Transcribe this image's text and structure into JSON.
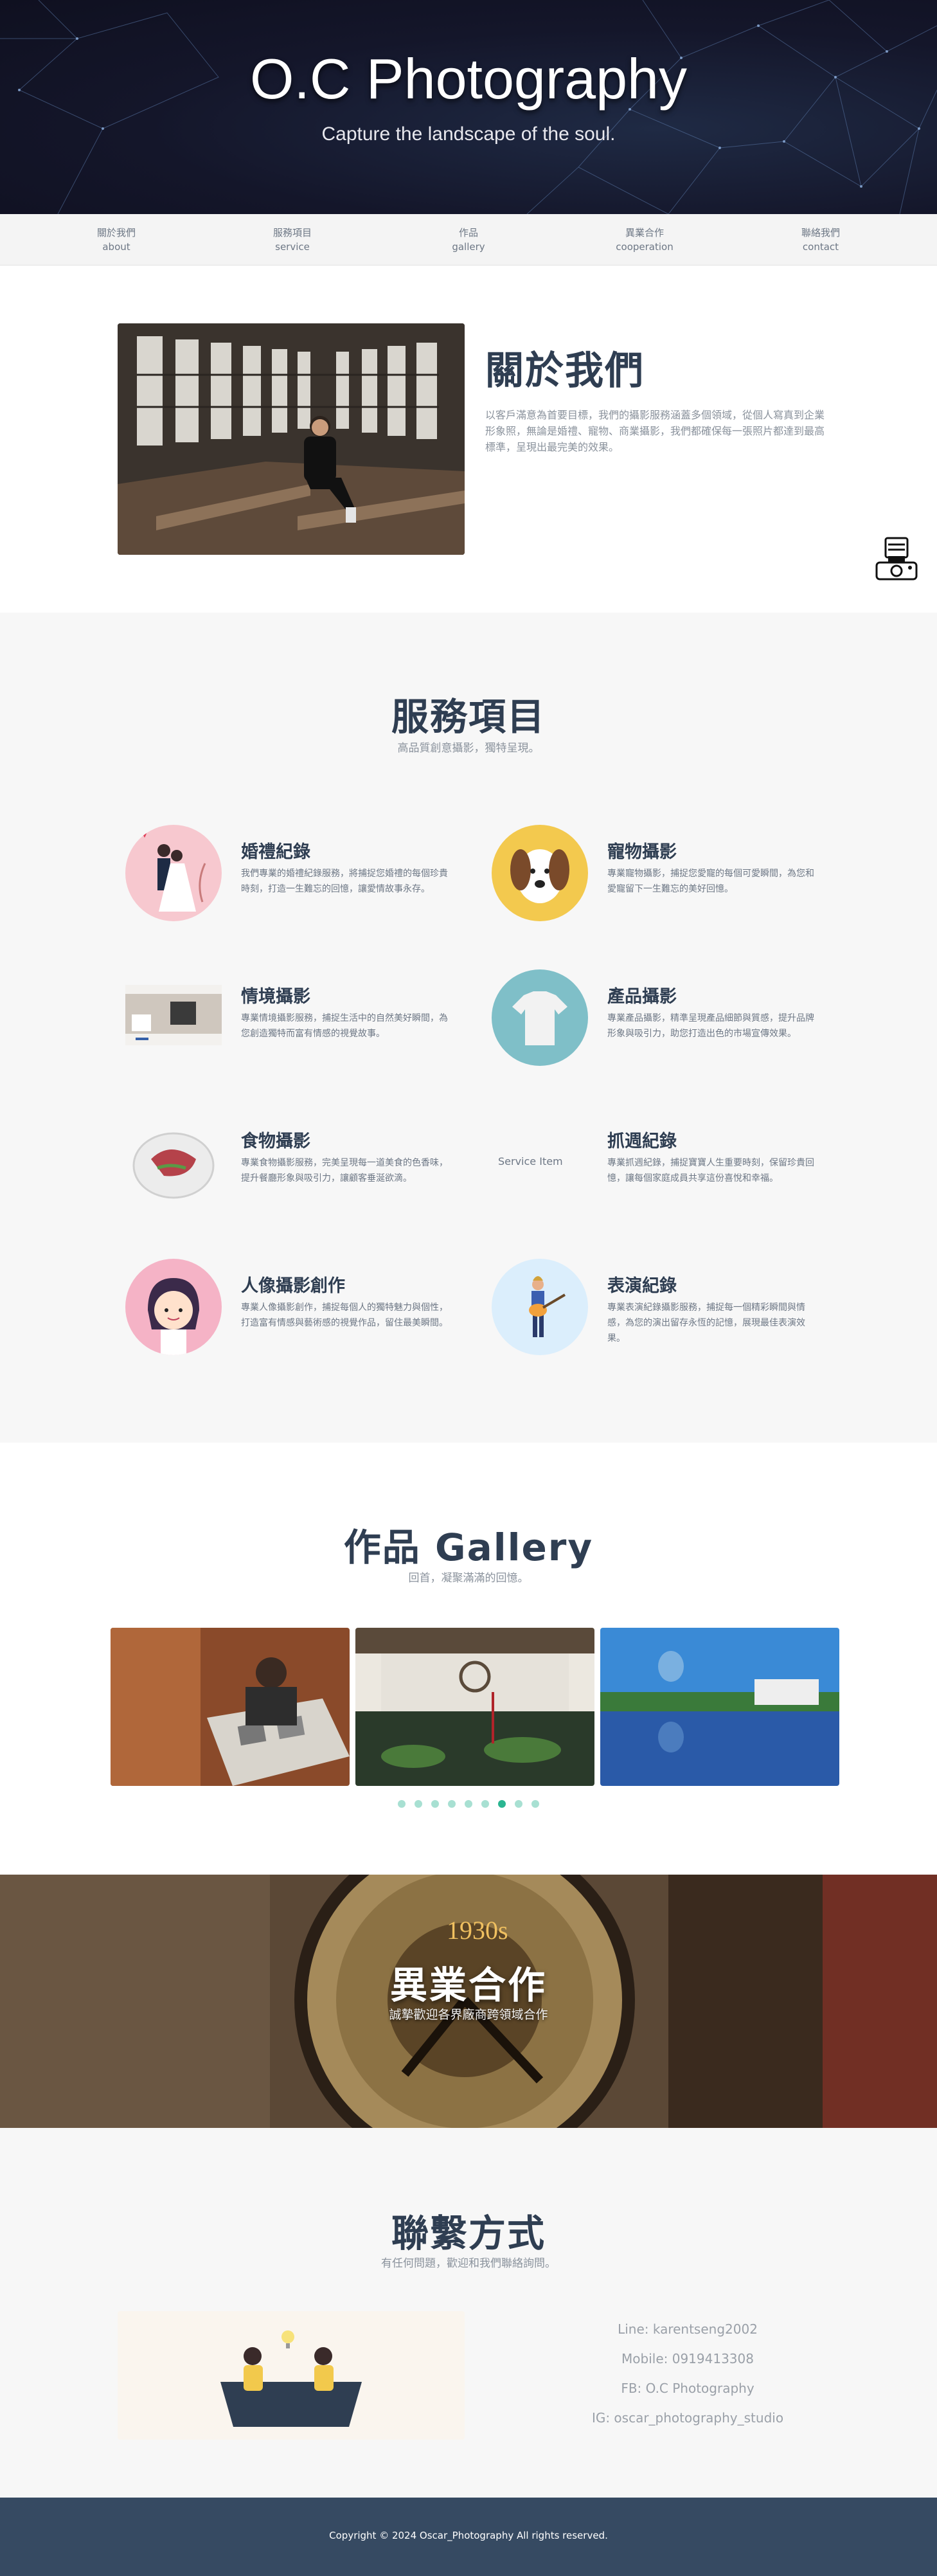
{
  "hero": {
    "title": "O.C Photography",
    "subtitle": "Capture the landscape of the soul."
  },
  "nav": {
    "items": [
      {
        "zh": "關於我們",
        "en": "about"
      },
      {
        "zh": "服務項目",
        "en": "service"
      },
      {
        "zh": "作品",
        "en": "gallery"
      },
      {
        "zh": "異業合作",
        "en": "cooperation"
      },
      {
        "zh": "聯絡我們",
        "en": "contact"
      }
    ]
  },
  "about": {
    "title": "關於我們",
    "text": "以客戶滿意為首要目標，我們的攝影服務涵蓋多個領域，從個人寫真到企業形象照，無論是婚禮、寵物、商業攝影，我們都確保每一張照片都達到最高標準，呈現出最完美的效果。"
  },
  "services": {
    "title": "服務項目",
    "subtitle": "高品質創意攝影，獨特呈現。",
    "items": [
      {
        "title": "婚禮紀錄",
        "desc": "我們專業的婚禮紀錄服務，將捕捉您婚禮的每個珍貴時刻，打造一生難忘的回憶，讓愛情故事永存。"
      },
      {
        "title": "寵物攝影",
        "desc": "專業寵物攝影，捕捉您愛寵的每個可愛瞬間，為您和愛寵留下一生難忘的美好回憶。"
      },
      {
        "title": "情境攝影",
        "desc": "專業情境攝影服務，捕捉生活中的自然美好瞬間，為您創造獨特而富有情感的視覺故事。"
      },
      {
        "title": "產品攝影",
        "desc": "專業產品攝影，精準呈現產品細節與質感，提升品牌形象與吸引力，助您打造出色的市場宣傳效果。"
      },
      {
        "title": "食物攝影",
        "desc": "專業食物攝影服務，完美呈現每一道美食的色香味，提升餐廳形象與吸引力，讓顧客垂涎欲滴。"
      },
      {
        "title": "抓週紀錄",
        "desc": "專業抓週紀錄，捕捉寶寶人生重要時刻，保留珍貴回憶，讓每個家庭成員共享這份喜悅和幸福。",
        "alt": "Service Item"
      },
      {
        "title": "人像攝影創作",
        "desc": "專業人像攝影創作，捕捉每個人的獨特魅力與個性，打造富有情感與藝術感的視覺作品，留住最美瞬間。"
      },
      {
        "title": "表演紀錄",
        "desc": "專業表演紀錄攝影服務，捕捉每一個精彩瞬間與情感，為您的演出留存永恆的記憶，展現最佳表演效果。"
      }
    ]
  },
  "gallery": {
    "title": "作品 Gallery",
    "subtitle": "回首，凝聚滿滿的回憶。",
    "dots": 9,
    "active_dot": 6
  },
  "coop": {
    "title": "異業合作",
    "subtitle": "誠摯歡迎各界廠商跨領域合作",
    "clock_sign": "1930s"
  },
  "contact": {
    "title": "聯繫方式",
    "subtitle": "有任何問題，歡迎和我們聯絡詢問。",
    "lines": [
      "Line: karentseng2002",
      "Mobile: 0919413308",
      "FB: O.C Photography",
      "IG: oscar_photography_studio"
    ]
  },
  "footer": {
    "copyright": "Copyright © 2024 Oscar_Photography All rights reserved."
  },
  "colors": {
    "heading": "#2f3e52",
    "accent_teal": "#2bb591",
    "footer_bg": "#364a62",
    "hero_bg": "#14162a"
  }
}
